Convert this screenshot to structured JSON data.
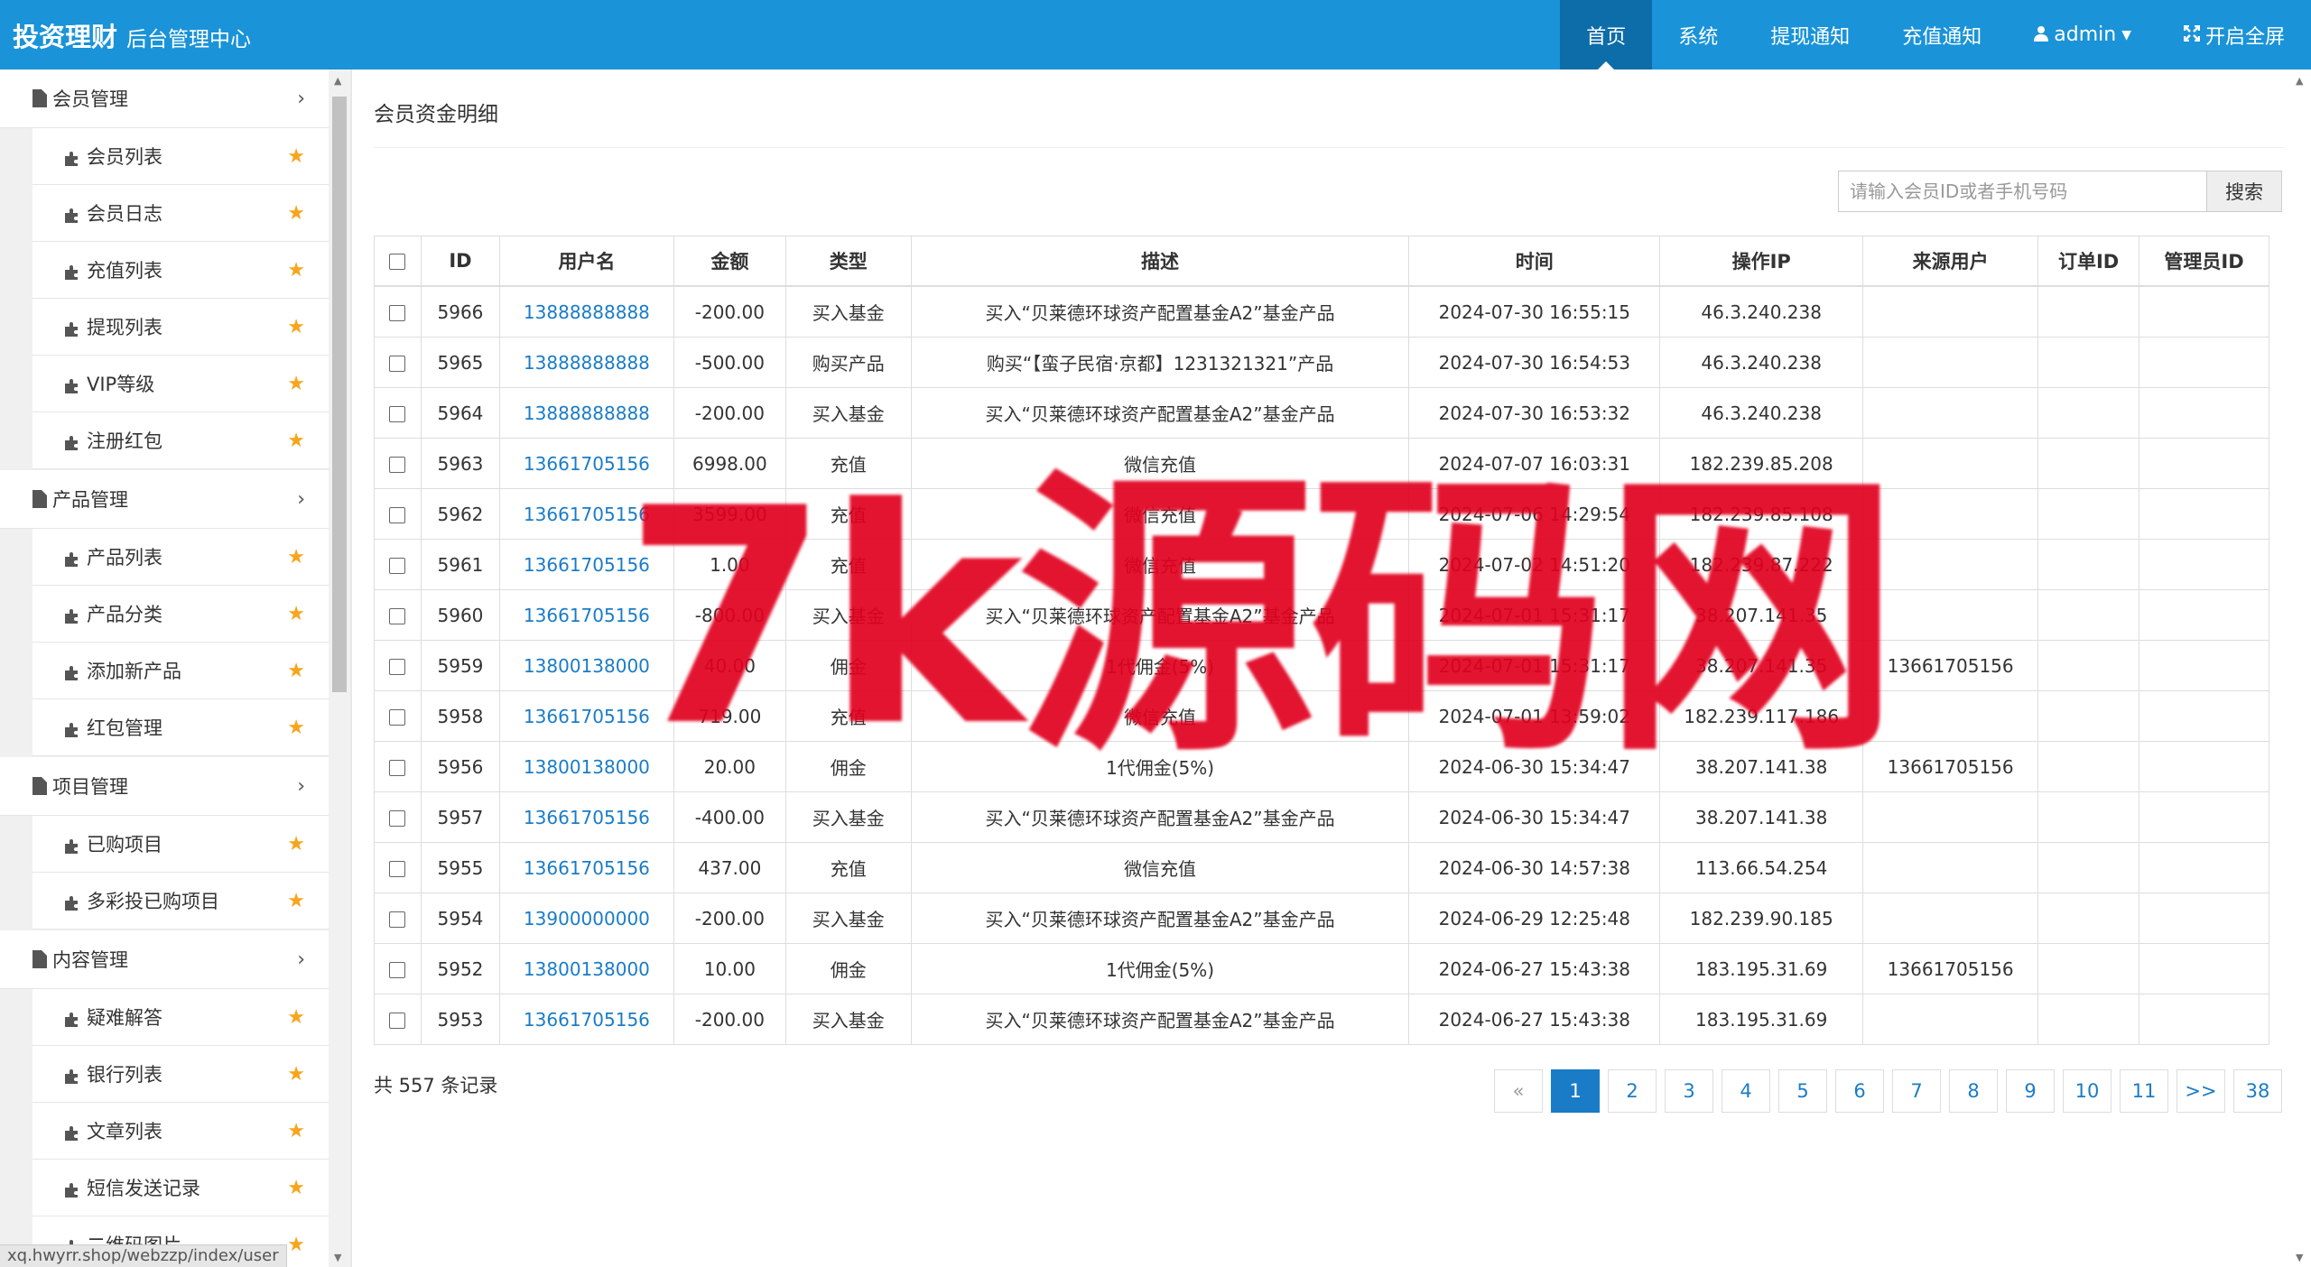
{
  "header": {
    "brand_title": "投资理财",
    "brand_subtitle": "后台管理中心",
    "nav": [
      {
        "label": "首页",
        "active": true
      },
      {
        "label": "系统"
      },
      {
        "label": "提现通知"
      },
      {
        "label": "充值通知"
      },
      {
        "label": "admin",
        "icon": "user-icon"
      },
      {
        "label": "开启全屏",
        "icon": "expand-icon"
      }
    ]
  },
  "sidebar": {
    "groups": [
      {
        "label": "会员管理",
        "items": [
          "会员列表",
          "会员日志",
          "充值列表",
          "提现列表",
          "VIP等级",
          "注册红包"
        ]
      },
      {
        "label": "产品管理",
        "items": [
          "产品列表",
          "产品分类",
          "添加新产品",
          "红包管理"
        ]
      },
      {
        "label": "项目管理",
        "items": [
          "已购项目",
          "多彩投已购项目"
        ]
      },
      {
        "label": "内容管理",
        "items": [
          "疑难解答",
          "银行列表",
          "文章列表",
          "短信发送记录",
          "二维码图片"
        ]
      }
    ],
    "status_url": "xq.hwyrr.shop/webzzp/index/user"
  },
  "main": {
    "title": "会员资金明细",
    "search": {
      "placeholder": "请输入会员ID或者手机号码",
      "button": "搜索"
    },
    "table": {
      "headers": [
        "ID",
        "用户名",
        "金额",
        "类型",
        "描述",
        "时间",
        "操作IP",
        "来源用户",
        "订单ID",
        "管理员ID"
      ],
      "rows": [
        [
          "5966",
          "13888888888",
          "-200.00",
          "买入基金",
          "买入“贝莱德环球资产配置基金A2”基金产品",
          "2024-07-30 16:55:15",
          "46.3.240.238",
          "",
          "",
          ""
        ],
        [
          "5965",
          "13888888888",
          "-500.00",
          "购买产品",
          "购买“【蛮子民宿·京都】1231321321”产品",
          "2024-07-30 16:54:53",
          "46.3.240.238",
          "",
          "",
          ""
        ],
        [
          "5964",
          "13888888888",
          "-200.00",
          "买入基金",
          "买入“贝莱德环球资产配置基金A2”基金产品",
          "2024-07-30 16:53:32",
          "46.3.240.238",
          "",
          "",
          ""
        ],
        [
          "5963",
          "13661705156",
          "6998.00",
          "充值",
          "微信充值",
          "2024-07-07 16:03:31",
          "182.239.85.208",
          "",
          "",
          ""
        ],
        [
          "5962",
          "13661705156",
          "3599.00",
          "充值",
          "微信充值",
          "2024-07-06 14:29:54",
          "182.239.85.108",
          "",
          "",
          ""
        ],
        [
          "5961",
          "13661705156",
          "1.00",
          "充值",
          "微信充值",
          "2024-07-02 14:51:20",
          "182.239.87.222",
          "",
          "",
          ""
        ],
        [
          "5960",
          "13661705156",
          "-800.00",
          "买入基金",
          "买入“贝莱德环球资产配置基金A2”基金产品",
          "2024-07-01 15:31:17",
          "38.207.141.35",
          "",
          "",
          ""
        ],
        [
          "5959",
          "13800138000",
          "40.00",
          "佣金",
          "1代佣金(5%)",
          "2024-07-01 15:31:17",
          "38.207.141.35",
          "13661705156",
          "",
          ""
        ],
        [
          "5958",
          "13661705156",
          "719.00",
          "充值",
          "微信充值",
          "2024-07-01 13:59:02",
          "182.239.117.186",
          "",
          "",
          ""
        ],
        [
          "5956",
          "13800138000",
          "20.00",
          "佣金",
          "1代佣金(5%)",
          "2024-06-30 15:34:47",
          "38.207.141.38",
          "13661705156",
          "",
          ""
        ],
        [
          "5957",
          "13661705156",
          "-400.00",
          "买入基金",
          "买入“贝莱德环球资产配置基金A2”基金产品",
          "2024-06-30 15:34:47",
          "38.207.141.38",
          "",
          "",
          ""
        ],
        [
          "5955",
          "13661705156",
          "437.00",
          "充值",
          "微信充值",
          "2024-06-30 14:57:38",
          "113.66.54.254",
          "",
          "",
          ""
        ],
        [
          "5954",
          "13900000000",
          "-200.00",
          "买入基金",
          "买入“贝莱德环球资产配置基金A2”基金产品",
          "2024-06-29 12:25:48",
          "182.239.90.185",
          "",
          "",
          ""
        ],
        [
          "5952",
          "13800138000",
          "10.00",
          "佣金",
          "1代佣金(5%)",
          "2024-06-27 15:43:38",
          "183.195.31.69",
          "13661705156",
          "",
          ""
        ],
        [
          "5953",
          "13661705156",
          "-200.00",
          "买入基金",
          "买入“贝莱德环球资产配置基金A2”基金产品",
          "2024-06-27 15:43:38",
          "183.195.31.69",
          "",
          "",
          ""
        ]
      ]
    },
    "total_text": "共 557 条记录",
    "pagination": [
      "«",
      "1",
      "2",
      "3",
      "4",
      "5",
      "6",
      "7",
      "8",
      "9",
      "10",
      "11",
      ">>",
      "38"
    ],
    "current_page": "1"
  },
  "watermark": "7k源码网"
}
